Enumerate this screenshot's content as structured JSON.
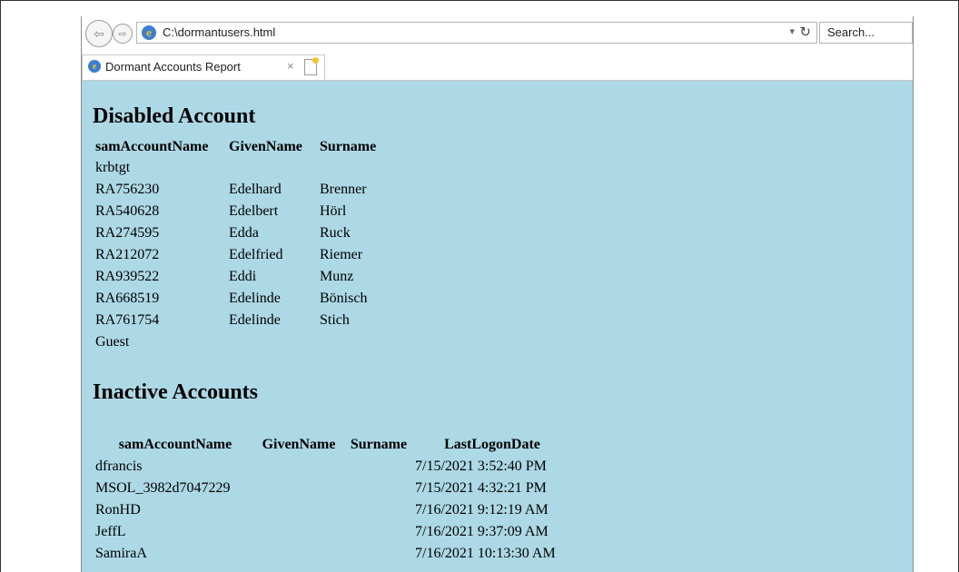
{
  "browser": {
    "url": "C:\\dormantusers.html",
    "search_placeholder": "Search...",
    "tab_title": "Dormant Accounts Report",
    "tab_close": "×"
  },
  "disabled": {
    "heading": "Disabled Account",
    "headers": [
      "samAccountName",
      "GivenName",
      "Surname"
    ],
    "rows": [
      [
        "krbtgt",
        "",
        ""
      ],
      [
        "RA756230",
        "Edelhard",
        "Brenner"
      ],
      [
        "RA540628",
        "Edelbert",
        "Hörl"
      ],
      [
        "RA274595",
        "Edda",
        "Ruck"
      ],
      [
        "RA212072",
        "Edelfried",
        "Riemer"
      ],
      [
        "RA939522",
        "Eddi",
        "Munz"
      ],
      [
        "RA668519",
        "Edelinde",
        "Bönisch"
      ],
      [
        "RA761754",
        "Edelinde",
        "Stich"
      ],
      [
        "Guest",
        "",
        ""
      ]
    ]
  },
  "inactive": {
    "heading": "Inactive Accounts",
    "headers": [
      "samAccountName",
      "GivenName",
      "Surname",
      "LastLogonDate"
    ],
    "rows": [
      [
        "dfrancis",
        "",
        "",
        "7/15/2021 3:52:40 PM"
      ],
      [
        "MSOL_3982d7047229",
        "",
        "",
        "7/15/2021 4:32:21 PM"
      ],
      [
        "RonHD",
        "",
        "",
        "7/16/2021 9:12:19 AM"
      ],
      [
        "JeffL",
        "",
        "",
        "7/16/2021 9:37:09 AM"
      ],
      [
        "SamiraA",
        "",
        "",
        "7/16/2021 10:13:30 AM"
      ]
    ]
  }
}
